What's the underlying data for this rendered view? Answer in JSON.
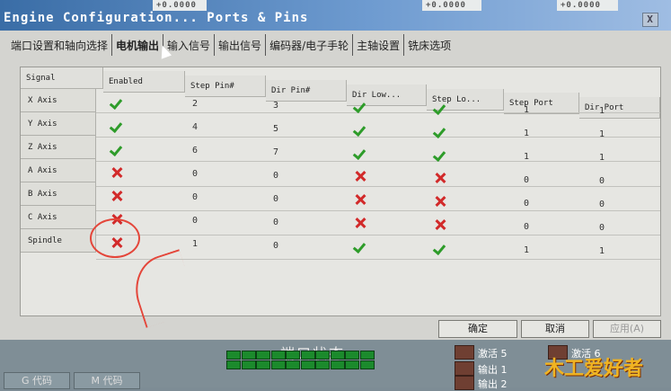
{
  "window": {
    "title": "Engine Configuration... Ports & Pins",
    "close_label": "X",
    "readouts": [
      "+0.0000",
      "+0.0000",
      "+0.0000"
    ]
  },
  "tabs": [
    {
      "label": "端口设置和轴向选择",
      "active": false
    },
    {
      "label": "电机输出",
      "active": true
    },
    {
      "label": "输入信号",
      "active": false
    },
    {
      "label": "输出信号",
      "active": false
    },
    {
      "label": "编码器/电子手轮",
      "active": false
    },
    {
      "label": "主轴设置",
      "active": false
    },
    {
      "label": "铣床选项",
      "active": false
    }
  ],
  "table": {
    "columns": [
      "Signal",
      "Enabled",
      "Step Pin#",
      "Dir Pin#",
      "Dir Low...",
      "Step Lo...",
      "Step Port",
      "Dir Port"
    ],
    "rows": [
      {
        "signal": "X Axis",
        "enabled": "on",
        "step_pin": "2",
        "dir_pin": "3",
        "dir_low": "on",
        "step_low": "on",
        "step_port": "1",
        "dir_port": "1"
      },
      {
        "signal": "Y Axis",
        "enabled": "on",
        "step_pin": "4",
        "dir_pin": "5",
        "dir_low": "on",
        "step_low": "on",
        "step_port": "1",
        "dir_port": "1"
      },
      {
        "signal": "Z Axis",
        "enabled": "on",
        "step_pin": "6",
        "dir_pin": "7",
        "dir_low": "on",
        "step_low": "on",
        "step_port": "1",
        "dir_port": "1"
      },
      {
        "signal": "A Axis",
        "enabled": "off",
        "step_pin": "0",
        "dir_pin": "0",
        "dir_low": "off",
        "step_low": "off",
        "step_port": "0",
        "dir_port": "0"
      },
      {
        "signal": "B Axis",
        "enabled": "off",
        "step_pin": "0",
        "dir_pin": "0",
        "dir_low": "off",
        "step_low": "off",
        "step_port": "0",
        "dir_port": "0"
      },
      {
        "signal": "C Axis",
        "enabled": "off",
        "step_pin": "0",
        "dir_pin": "0",
        "dir_low": "off",
        "step_low": "off",
        "step_port": "0",
        "dir_port": "0"
      },
      {
        "signal": "Spindle",
        "enabled": "off",
        "step_pin": "1",
        "dir_pin": "0",
        "dir_low": "on",
        "step_low": "on",
        "step_port": "1",
        "dir_port": "1"
      }
    ]
  },
  "buttons": {
    "ok": "确定",
    "cancel": "取消",
    "apply": "应用(A)"
  },
  "bottom": {
    "ports_status": "端口状态",
    "status_items": [
      "激活 5",
      "激活 6",
      "输出 1",
      "输出 2"
    ],
    "code_tabs": [
      "G 代码",
      "M 代码"
    ],
    "logo_text": "木工爱好者"
  },
  "colors": {
    "enabled_check": "#2e9c2a",
    "disabled_x": "#d22a2a",
    "annotation": "#e4463a"
  }
}
